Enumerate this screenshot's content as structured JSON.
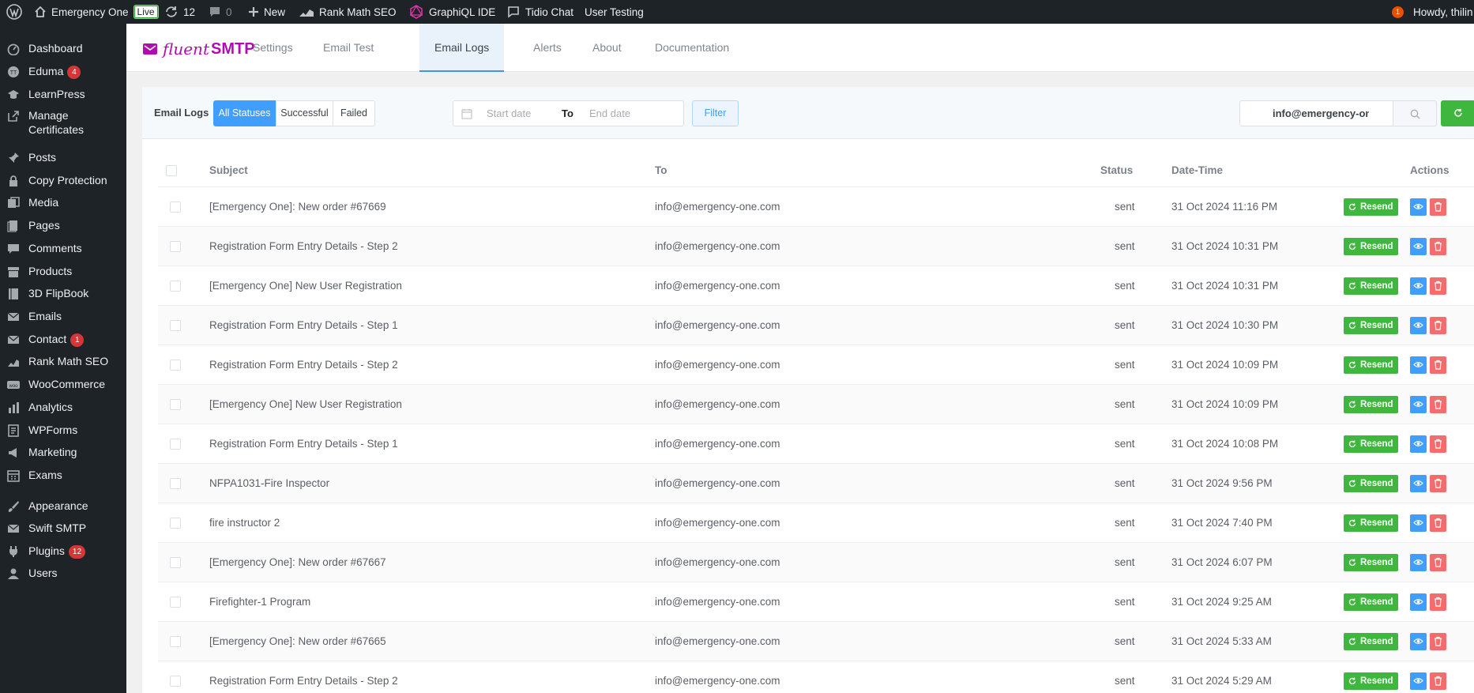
{
  "adminbar": {
    "site_name": "Emergency One",
    "live_badge": "Live",
    "updates_count": "12",
    "comments_count": "0",
    "new_label": "New",
    "rank_math": "Rank Math SEO",
    "graphiql": "GraphiQL IDE",
    "tidio": "Tidio Chat",
    "user_testing": "User Testing",
    "notification_count": "1",
    "howdy": "Howdy, thilin"
  },
  "sidebar": {
    "items": [
      {
        "label": "Dashboard",
        "icon": "dashboard-icon"
      },
      {
        "label": "Eduma",
        "icon": "eduma-icon",
        "badge": "4"
      },
      {
        "label": "LearnPress",
        "icon": "learnpress-icon"
      },
      {
        "label": "Manage\nCertificates",
        "label_line1": "Manage",
        "label_line2": "Certificates",
        "icon": "external-link-icon"
      },
      {
        "label": "Posts",
        "icon": "pin-icon"
      },
      {
        "label": "Copy Protection",
        "icon": "lock-icon"
      },
      {
        "label": "Media",
        "icon": "media-icon"
      },
      {
        "label": "Pages",
        "icon": "pages-icon"
      },
      {
        "label": "Comments",
        "icon": "comment-icon"
      },
      {
        "label": "Products",
        "icon": "archive-icon"
      },
      {
        "label": "3D FlipBook",
        "icon": "book-icon"
      },
      {
        "label": "Emails",
        "icon": "email-icon"
      },
      {
        "label": "Contact",
        "icon": "email-icon",
        "badge": "1"
      },
      {
        "label": "Rank Math SEO",
        "icon": "rankmath-icon"
      },
      {
        "label": "WooCommerce",
        "icon": "woo-icon"
      },
      {
        "label": "Analytics",
        "icon": "chart-icon"
      },
      {
        "label": "WPForms",
        "icon": "forms-icon"
      },
      {
        "label": "Marketing",
        "icon": "megaphone-icon"
      },
      {
        "label": "Exams",
        "icon": "calendar-icon"
      },
      {
        "label": "Appearance",
        "icon": "brush-icon"
      },
      {
        "label": "Swift SMTP",
        "icon": "email-icon"
      },
      {
        "label": "Plugins",
        "icon": "plugin-icon",
        "badge": "12"
      },
      {
        "label": "Users",
        "icon": "user-icon"
      }
    ]
  },
  "header": {
    "brand_fluent": "fluent",
    "brand_smtp": "SMTP",
    "tabs": [
      "Settings",
      "Email Test",
      "Email Logs",
      "Alerts",
      "About",
      "Documentation"
    ],
    "active_tab": "Email Logs"
  },
  "filters": {
    "label": "Email Logs",
    "statuses": [
      "All Statuses",
      "Successful",
      "Failed"
    ],
    "active_status": "All Statuses",
    "start_placeholder": "Start date",
    "to_label": "To",
    "end_placeholder": "End date",
    "filter_button": "Filter",
    "search_value": "info@emergency-one.com"
  },
  "table": {
    "columns": {
      "subject": "Subject",
      "to": "To",
      "status": "Status",
      "datetime": "Date-Time",
      "actions": "Actions"
    },
    "resend_label": "Resend",
    "rows": [
      {
        "subject": "[Emergency One]: New order #67669",
        "to": "info@emergency-one.com",
        "status": "sent",
        "datetime": "31 Oct 2024 11:16 PM"
      },
      {
        "subject": "Registration Form Entry Details - Step 2",
        "to": "info@emergency-one.com",
        "status": "sent",
        "datetime": "31 Oct 2024 10:31 PM"
      },
      {
        "subject": "[Emergency One] New User Registration",
        "to": "info@emergency-one.com",
        "status": "sent",
        "datetime": "31 Oct 2024 10:31 PM"
      },
      {
        "subject": "Registration Form Entry Details - Step 1",
        "to": "info@emergency-one.com",
        "status": "sent",
        "datetime": "31 Oct 2024 10:30 PM"
      },
      {
        "subject": "Registration Form Entry Details - Step 2",
        "to": "info@emergency-one.com",
        "status": "sent",
        "datetime": "31 Oct 2024 10:09 PM"
      },
      {
        "subject": "[Emergency One] New User Registration",
        "to": "info@emergency-one.com",
        "status": "sent",
        "datetime": "31 Oct 2024 10:09 PM"
      },
      {
        "subject": "Registration Form Entry Details - Step 1",
        "to": "info@emergency-one.com",
        "status": "sent",
        "datetime": "31 Oct 2024 10:08 PM"
      },
      {
        "subject": "NFPA1031-Fire Inspector",
        "to": "info@emergency-one.com",
        "status": "sent",
        "datetime": "31 Oct 2024 9:56 PM"
      },
      {
        "subject": "fire instructor 2",
        "to": "info@emergency-one.com",
        "status": "sent",
        "datetime": "31 Oct 2024 7:40 PM"
      },
      {
        "subject": "[Emergency One]: New order #67667",
        "to": "info@emergency-one.com",
        "status": "sent",
        "datetime": "31 Oct 2024 6:07 PM"
      },
      {
        "subject": "Firefighter-1 Program",
        "to": "info@emergency-one.com",
        "status": "sent",
        "datetime": "31 Oct 2024 9:25 AM"
      },
      {
        "subject": "[Emergency One]: New order #67665",
        "to": "info@emergency-one.com",
        "status": "sent",
        "datetime": "31 Oct 2024 5:33 AM"
      },
      {
        "subject": "Registration Form Entry Details - Step 2",
        "to": "info@emergency-one.com",
        "status": "sent",
        "datetime": "31 Oct 2024 5:29 AM"
      }
    ]
  },
  "colors": {
    "admin_bg": "#1d2327",
    "brand": "#b10cb1",
    "primary": "#409eff",
    "success": "#3fb73f",
    "danger": "#f56c6c"
  }
}
